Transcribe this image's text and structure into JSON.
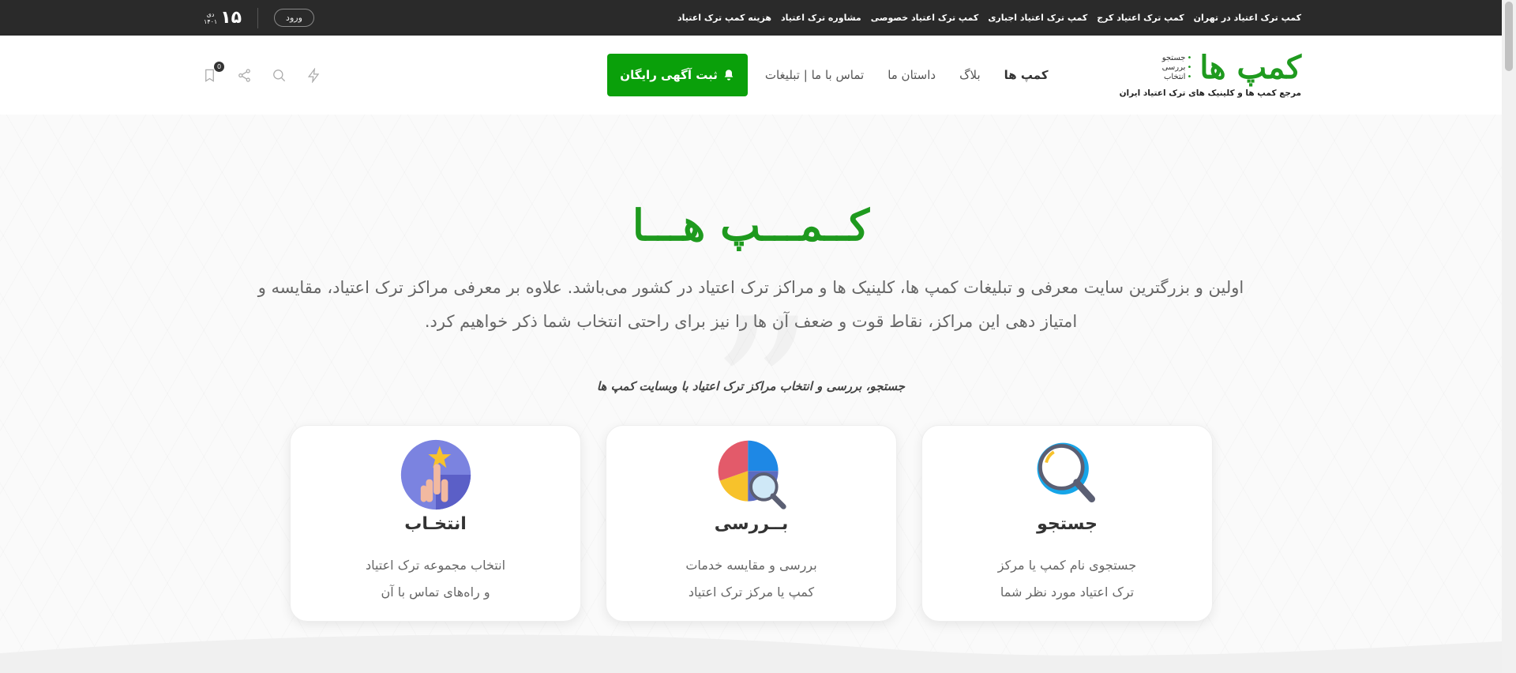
{
  "topbar": {
    "links": [
      "کمپ ترک اعتیاد در تهران",
      "کمپ ترک اعتیاد کرج",
      "کمپ ترک اعتیاد اجباری",
      "کمپ ترک اعتیاد خصوصی",
      "مشاوره ترک اعتیاد",
      "هزینه کمپ ترک اعتیاد"
    ],
    "login": "ورود",
    "date_day": "۱۵",
    "date_month": "دی",
    "date_year": "۱۴۰۱"
  },
  "brand": {
    "logo": "کمپ ها",
    "steps": [
      "جستجو",
      "بررسی",
      "انتخاب"
    ],
    "tagline": "مرجع کمپ ها و کلینیک های ترک اعتیاد ایران"
  },
  "nav": {
    "items": [
      "کمپ ها",
      "بلاگ",
      "داستان ما",
      "تماس با ما | تبلیغات"
    ],
    "cta": "ثبت آگهی رایگان"
  },
  "header_icons": {
    "bookmark_count": "0"
  },
  "hero": {
    "title": "کــمـــپ هـــا",
    "desc_line1": "اولین و بزرگترین سایت معرفی و تبلیغات کمپ ها، کلینیک ها و مراکز ترک اعتیاد در کشور می‌باشد. علاوه بر معرفی مراکز ترک اعتیاد، مقایسه و",
    "desc_line2": "امتیاز دهی این مراکز، نقاط قوت و ضعف آن ها را نیز برای راحتی انتخاب شما ذکر خواهیم کرد.",
    "subtitle": "جستجو، بررسی و انتخاب مراکز ترک اعتیاد با وبسایت کمپ ها"
  },
  "cards": [
    {
      "title": "جستجو",
      "line1": "جستجوی نام کمپ یا مرکز",
      "line2": "ترک اعتیاد مورد نظر شما",
      "icon": "magnifier-icon"
    },
    {
      "title": "بــررسی",
      "line1": "بررسی و مقایسه خدمات",
      "line2": "کمپ یا مرکز ترک اعتیاد",
      "icon": "pie-chart-search-icon"
    },
    {
      "title": "انتخـاب",
      "line1": "انتخاب مجموعه ترک اعتیاد",
      "line2": "و راه‌های تماس با آن",
      "icon": "star-hand-icon"
    }
  ],
  "colors": {
    "brand_green": "#1e9a1e",
    "cta_green": "#0aa00a",
    "topbar_bg": "#2a2a2a"
  }
}
